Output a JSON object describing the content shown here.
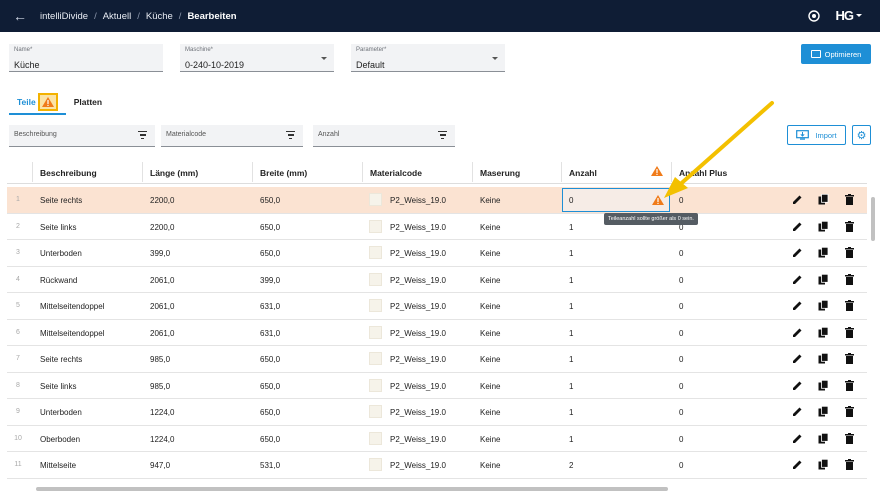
{
  "breadcrumb": [
    "intelliDivide",
    "Aktuell",
    "Küche",
    "Bearbeiten"
  ],
  "header": {
    "logo": "HG",
    "icons": [
      "back-arrow-icon",
      "help-icon",
      "chevron-down-icon"
    ]
  },
  "form": {
    "name_label": "Name*",
    "name_value": "Küche",
    "machine_label": "Maschine*",
    "machine_value": "0-240-10-2019",
    "params_label": "Parameter*",
    "params_value": "Default"
  },
  "optimize_label": "Optimieren",
  "tabs": [
    {
      "label": "Teile"
    },
    {
      "label": "Platten"
    }
  ],
  "filters": {
    "description": "Beschreibung",
    "material": "Materialcode",
    "count": "Anzahl"
  },
  "import_label": "Import",
  "columns": [
    "Beschreibung",
    "Länge (mm)",
    "Breite (mm)",
    "Materialcode",
    "Maserung",
    "Anzahl",
    "Anzahl Plus"
  ],
  "rows": [
    {
      "i": "1",
      "desc": "Seite rechts",
      "len": "2200,0",
      "wid": "650,0",
      "mat": "P2_Weiss_19.0",
      "grain": "Keine",
      "count": "0",
      "plus": "0"
    },
    {
      "i": "2",
      "desc": "Seite links",
      "len": "2200,0",
      "wid": "650,0",
      "mat": "P2_Weiss_19.0",
      "grain": "Keine",
      "count": "1",
      "plus": "0"
    },
    {
      "i": "3",
      "desc": "Unterboden",
      "len": "399,0",
      "wid": "650,0",
      "mat": "P2_Weiss_19.0",
      "grain": "Keine",
      "count": "1",
      "plus": "0"
    },
    {
      "i": "4",
      "desc": "Rückwand",
      "len": "2061,0",
      "wid": "399,0",
      "mat": "P2_Weiss_19.0",
      "grain": "Keine",
      "count": "1",
      "plus": "0"
    },
    {
      "i": "5",
      "desc": "Mittelseitendoppel",
      "len": "2061,0",
      "wid": "631,0",
      "mat": "P2_Weiss_19.0",
      "grain": "Keine",
      "count": "1",
      "plus": "0"
    },
    {
      "i": "6",
      "desc": "Mittelseitendoppel",
      "len": "2061,0",
      "wid": "631,0",
      "mat": "P2_Weiss_19.0",
      "grain": "Keine",
      "count": "1",
      "plus": "0"
    },
    {
      "i": "7",
      "desc": "Seite rechts",
      "len": "985,0",
      "wid": "650,0",
      "mat": "P2_Weiss_19.0",
      "grain": "Keine",
      "count": "1",
      "plus": "0"
    },
    {
      "i": "8",
      "desc": "Seite links",
      "len": "985,0",
      "wid": "650,0",
      "mat": "P2_Weiss_19.0",
      "grain": "Keine",
      "count": "1",
      "plus": "0"
    },
    {
      "i": "9",
      "desc": "Unterboden",
      "len": "1224,0",
      "wid": "650,0",
      "mat": "P2_Weiss_19.0",
      "grain": "Keine",
      "count": "1",
      "plus": "0"
    },
    {
      "i": "10",
      "desc": "Oberboden",
      "len": "1224,0",
      "wid": "650,0",
      "mat": "P2_Weiss_19.0",
      "grain": "Keine",
      "count": "1",
      "plus": "0"
    },
    {
      "i": "11",
      "desc": "Mittelseite",
      "len": "947,0",
      "wid": "531,0",
      "mat": "P2_Weiss_19.0",
      "grain": "Keine",
      "count": "2",
      "plus": "0"
    }
  ],
  "tooltip": "Teileanzahl sollte größer als 0 sein.",
  "colors": {
    "accent": "#1e8fd6",
    "topbar": "#0f1d35",
    "warning": "#f07b1a",
    "annotation": "#f3b200",
    "selected_row": "#fbe3d2"
  }
}
